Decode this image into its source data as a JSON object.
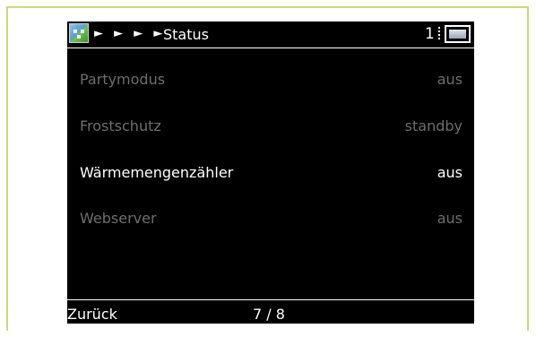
{
  "header": {
    "breadcrumb_arrows": "► ► ► ►",
    "title": "Status",
    "page_number": "1",
    "app_icon": "house-icon",
    "status_icon": "sd-card-icon"
  },
  "rows": [
    {
      "label": "Partymodus",
      "value": "aus",
      "state": "dim"
    },
    {
      "label": "Frostschutz",
      "value": "standby",
      "state": "dim"
    },
    {
      "label": "Wärmemengenzähler",
      "value": "aus",
      "state": "selected"
    },
    {
      "label": "Webserver",
      "value": "aus",
      "state": "dim"
    }
  ],
  "footer": {
    "back_label": "Zurück",
    "pager": "7 / 8"
  },
  "colors": {
    "frame_border": "#c8dc78",
    "screen_bg": "#000000",
    "dim_text": "#6e6e6e",
    "active_text": "#ffffff"
  }
}
